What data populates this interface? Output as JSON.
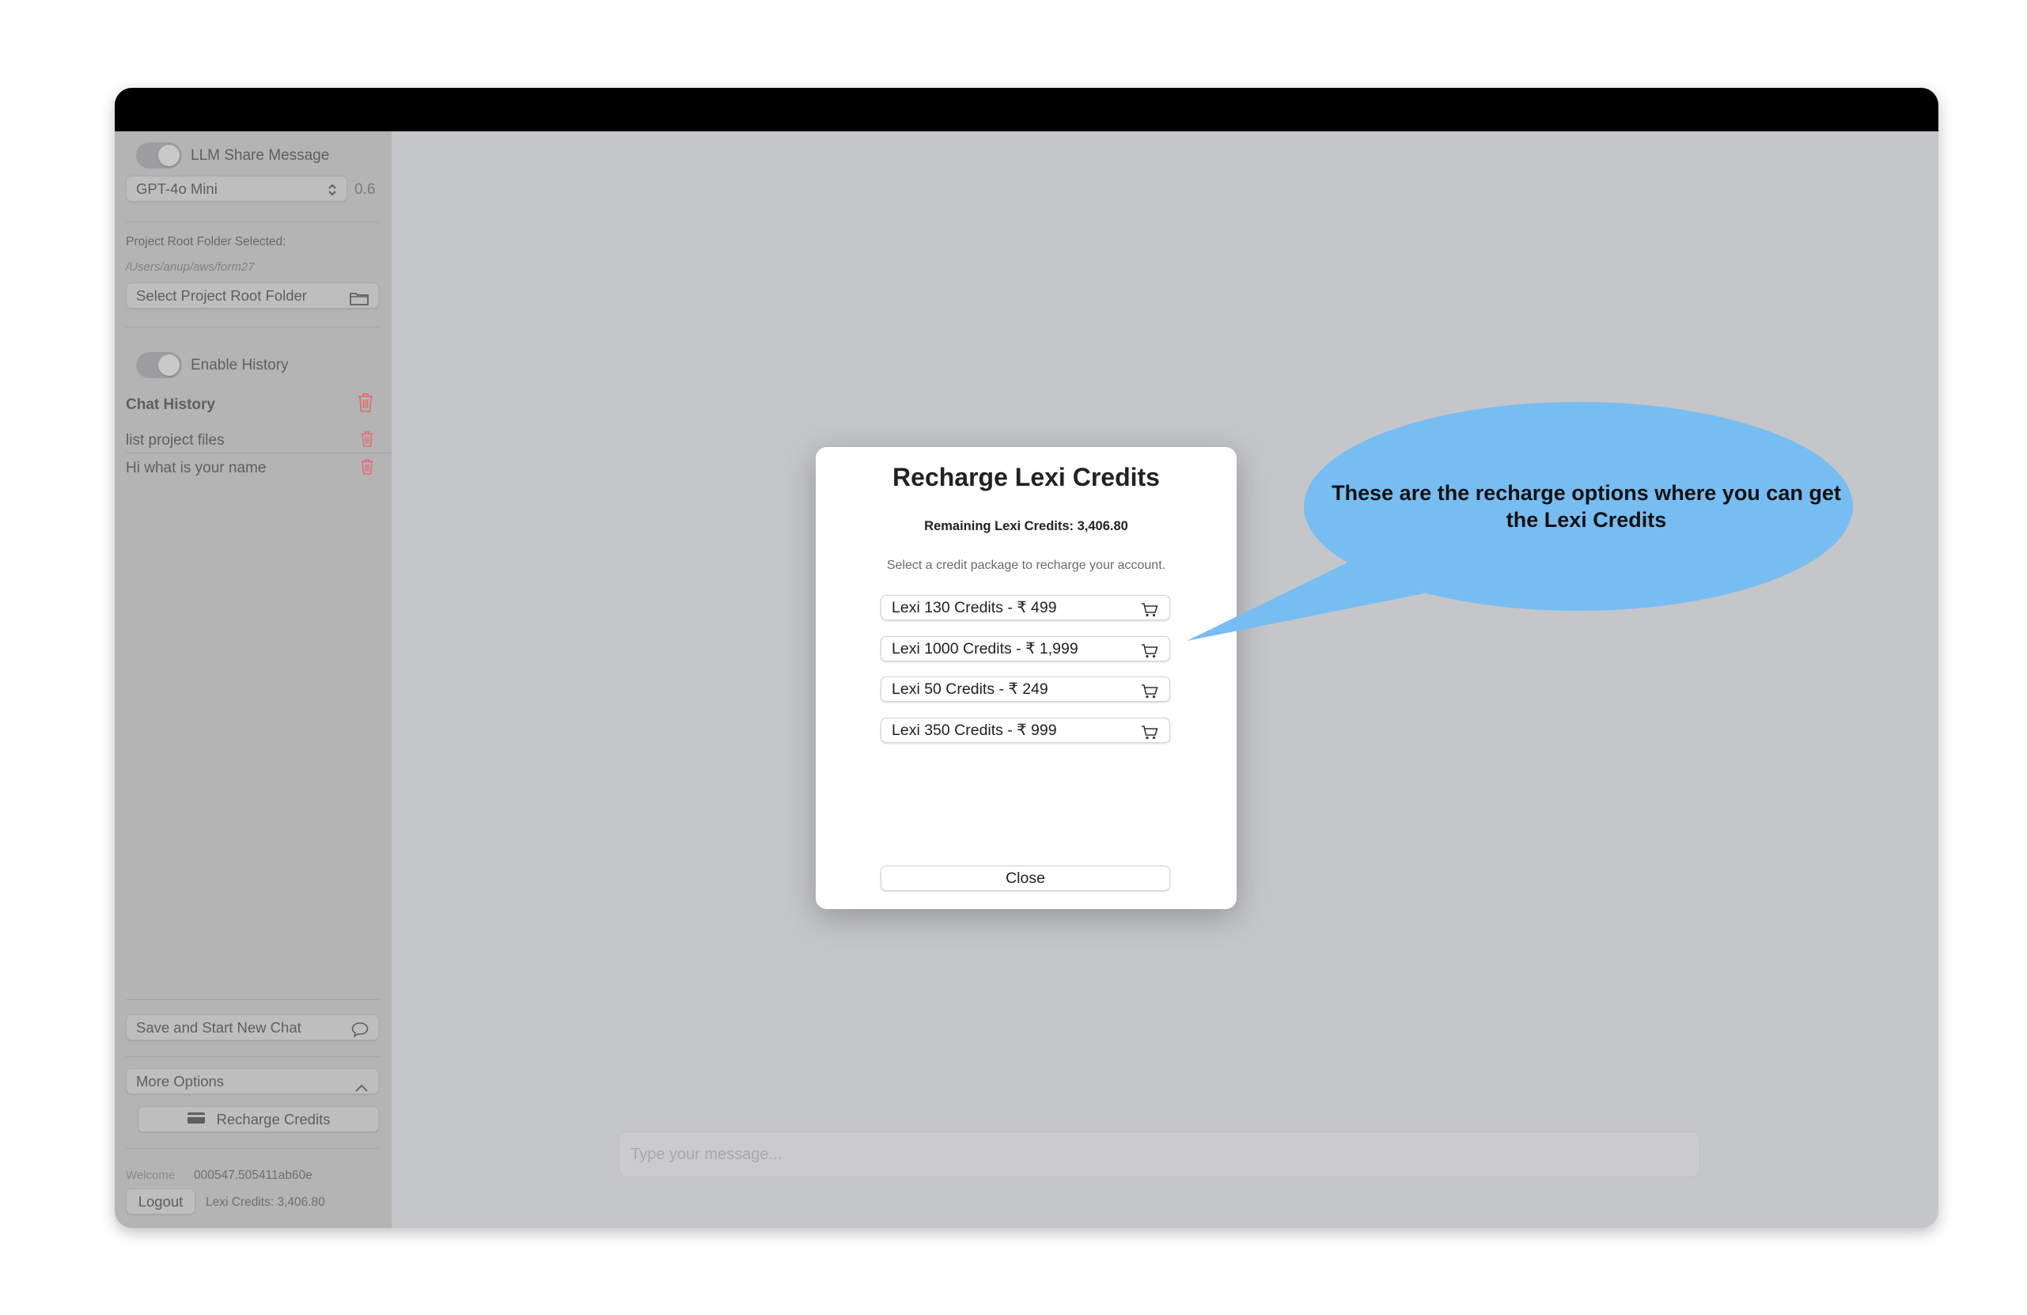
{
  "sidebar": {
    "llm_share_label": "LLM Share Message",
    "model_select_value": "GPT-4o Mini",
    "temperature": "0.6",
    "project_root_label": "Project Root Folder Selected:",
    "project_root_path": "/Users/anup/aws/form27",
    "select_folder_label": "Select Project Root Folder",
    "enable_history_label": "Enable History",
    "chat_history_heading": "Chat History",
    "history_items": [
      "list project files",
      "Hi what is your name"
    ],
    "save_new_chat_label": "Save and Start New Chat",
    "more_options_label": "More Options",
    "recharge_label": "Recharge Credits",
    "welcome_label": "Welcome",
    "user_id": "000547.505411ab60e",
    "logout_label": "Logout",
    "credits_label": "Lexi Credits: 3,406.80"
  },
  "main": {
    "message_placeholder": "Type your message..."
  },
  "modal": {
    "title": "Recharge Lexi Credits",
    "remaining": "Remaining Lexi Credits: 3,406.80",
    "instruction": "Select a credit package to recharge your account.",
    "packages": [
      "Lexi 130 Credits - ₹ 499",
      "Lexi 1000 Credits - ₹ 1,999",
      "Lexi 50 Credits - ₹ 249",
      "Lexi 350 Credits - ₹ 999"
    ],
    "close_label": "Close"
  },
  "callout": {
    "text": "These are the recharge options where you can get the Lexi Credits",
    "color": "#77bdf2"
  },
  "icons": {
    "folder": "folder-icon",
    "trash": "trash-icon",
    "chat": "chat-bubble-icon",
    "chevron": "chevron-up-icon",
    "card": "credit-card-icon",
    "cart": "cart-icon"
  }
}
